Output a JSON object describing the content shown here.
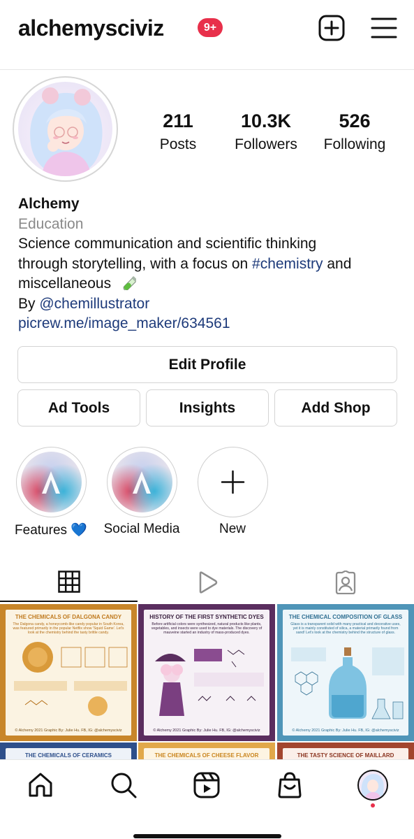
{
  "header": {
    "username": "alchemysciviz",
    "notification_badge": "9+",
    "icons": [
      "plus-square-icon",
      "menu-icon"
    ]
  },
  "profile": {
    "stats": {
      "posts": {
        "value": "211",
        "label": "Posts"
      },
      "followers": {
        "value": "10.3K",
        "label": "Followers"
      },
      "following": {
        "value": "526",
        "label": "Following"
      }
    },
    "name": "Alchemy",
    "category": "Education",
    "bio_line1": "Science communication and scientific thinking",
    "bio_line2_pre": "through storytelling, with a focus on ",
    "bio_hashtag": "#chemistry",
    "bio_line2_post": " and",
    "bio_line3": "miscellaneous",
    "bio_emoji": "test-tube-icon",
    "by_label": "By ",
    "mention": "@chemillustrator",
    "website": "picrew.me/image_maker/634561"
  },
  "buttons": {
    "edit_profile": "Edit Profile",
    "ad_tools": "Ad Tools",
    "insights": "Insights",
    "add_shop": "Add Shop"
  },
  "highlights": [
    {
      "label": "Features 💙"
    },
    {
      "label": "Social Media"
    },
    {
      "label": "New"
    }
  ],
  "tabs": [
    "grid-icon",
    "reels-play-icon",
    "tagged-icon"
  ],
  "posts": [
    {
      "title": "THE CHEMICALS OF DALGONA CANDY",
      "subtitle": "The Dalgona candy, a honeycomb-like candy popular in South Korea, was featured primarily in the popular Netflix show 'Squid Game'. Let's look at the chemistry behind the tasty brittle candy.",
      "footer": "© Alchemy 2021 Graphic By: Julie Hu. FB, IG: @alchemysciviz",
      "bg": "#c8862a",
      "panel": "#fbf3e2",
      "title_color": "#c07a1e"
    },
    {
      "title": "HISTORY OF THE FIRST SYNTHETIC DYES",
      "subtitle": "Before artificial colors were synthesized, natural products like plants, vegetables, and insects were used to dye materials. The discovery of mauveine started an industry of mass-produced dyes.",
      "footer": "© Alchemy 2021 Graphic By: Julie Hu. FB, IG: @alchemysciviz",
      "bg": "#5a2e5f",
      "panel": "#f6f1f6",
      "title_color": "#3b2140"
    },
    {
      "title": "THE CHEMICAL COMPOSITION OF GLASS",
      "subtitle": "Glass is a transparent solid with many practical and decorative uses, yet it is mainly constituted of silica, a material primarily found from sand! Let's look at the chemistry behind the structure of glass.",
      "footer": "© Alchemy 2021 Graphic By: Julie Hu. FB, IG: @alchemysciviz",
      "bg": "#4f95b8",
      "panel": "#eef6fa",
      "title_color": "#2f6f92"
    },
    {
      "title": "THE CHEMICALS OF CERAMICS",
      "bg": "#2e4f8a",
      "panel": "#eef2f8",
      "title_color": "#2e4f8a"
    },
    {
      "title": "THE CHEMICALS OF CHEESE FLAVOR",
      "bg": "#e1a84a",
      "panel": "#fdf4e2",
      "title_color": "#c9851f"
    },
    {
      "title": "THE TASTY SCIENCE OF MAILLARD REACTION",
      "bg": "#a2452e",
      "panel": "#fbefe9",
      "title_color": "#8a3420"
    }
  ],
  "bottom_nav": [
    "home-icon",
    "search-icon",
    "reels-icon",
    "shop-icon",
    "profile-avatar"
  ],
  "colors": {
    "accent_link": "#1d3a7a",
    "badge": "#e8304b",
    "muted": "#8a8a8a"
  }
}
